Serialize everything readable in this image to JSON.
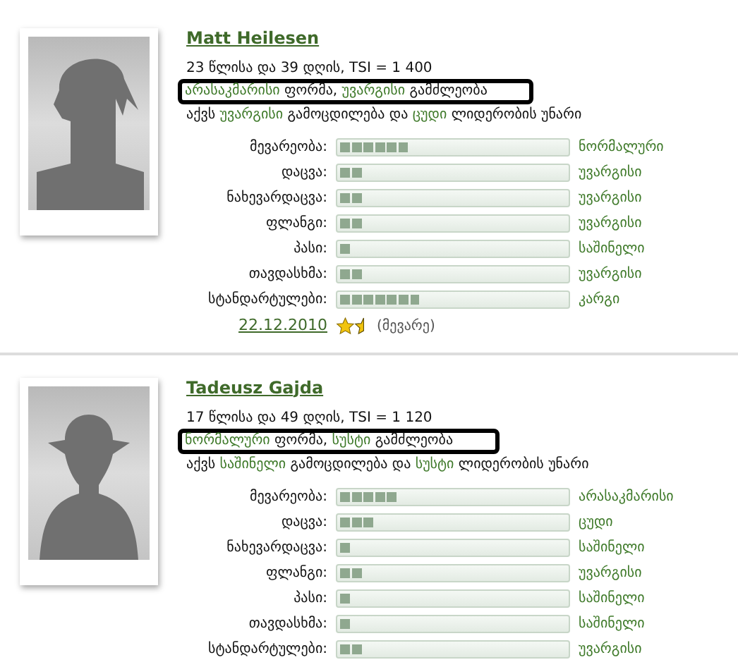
{
  "players": [
    {
      "name": "Matt Heilesen",
      "avatar": {
        "kind": "hair"
      },
      "age_line": "23 წლისა და 39 დღის, TSI = 1 400",
      "form_line": [
        {
          "text": "არასაკმარისი",
          "rated": true
        },
        {
          "text": " ფორმა, ",
          "rated": false
        },
        {
          "text": "უვარგისი",
          "rated": true
        },
        {
          "text": " გამძლეობა",
          "rated": false
        }
      ],
      "form_highlighted": true,
      "experience_line": [
        {
          "text": "აქვს ",
          "rated": false
        },
        {
          "text": "უვარგისი",
          "rated": true
        },
        {
          "text": " გამოცდილება და ",
          "rated": false
        },
        {
          "text": "ცუდი",
          "rated": true
        },
        {
          "text": " ლიდერობის უნარი",
          "rated": false
        }
      ],
      "skills": [
        {
          "label": "მევარეობა:",
          "level": 0.3,
          "rating": "ნორმალური"
        },
        {
          "label": "დაცვა:",
          "level": 0.1,
          "rating": "უვარგისი"
        },
        {
          "label": "ნახევარდაცვა:",
          "level": 0.1,
          "rating": "უვარგისი"
        },
        {
          "label": "ფლანგი:",
          "level": 0.1,
          "rating": "უვარგისი"
        },
        {
          "label": "პასი:",
          "level": 0.05,
          "rating": "საშინელი"
        },
        {
          "label": "თავდასხმა:",
          "level": 0.1,
          "rating": "უვარგისი"
        },
        {
          "label": "სტანდარტულები:",
          "level": 0.35,
          "rating": "კარგი"
        }
      ],
      "date": "22.12.2010",
      "rating_icon": {
        "kind": "star_and_half"
      },
      "position": "(მევარე)"
    },
    {
      "name": "Tadeusz Gajda",
      "avatar": {
        "kind": "bald"
      },
      "age_line": "17 წლისა და 49 დღის, TSI = 1 120",
      "form_line": [
        {
          "text": "ნორმალური",
          "rated": true
        },
        {
          "text": " ფორმა, ",
          "rated": false
        },
        {
          "text": "სუსტი",
          "rated": true
        },
        {
          "text": " გამძლეობა",
          "rated": false
        }
      ],
      "form_highlighted": true,
      "experience_line": [
        {
          "text": "აქვს ",
          "rated": false
        },
        {
          "text": "საშინელი",
          "rated": true
        },
        {
          "text": " გამოცდილება და ",
          "rated": false
        },
        {
          "text": "სუსტი",
          "rated": true
        },
        {
          "text": " ლიდერობის უნარი",
          "rated": false
        }
      ],
      "skills": [
        {
          "label": "მევარეობა:",
          "level": 0.25,
          "rating": "არასაკმარისი"
        },
        {
          "label": "დაცვა:",
          "level": 0.15,
          "rating": "ცუდი"
        },
        {
          "label": "ნახევარდაცვა:",
          "level": 0.05,
          "rating": "საშინელი"
        },
        {
          "label": "ფლანგი:",
          "level": 0.1,
          "rating": "უვარგისი"
        },
        {
          "label": "პასი:",
          "level": 0.05,
          "rating": "საშინელი"
        },
        {
          "label": "თავდასხმა:",
          "level": 0.05,
          "rating": "საშინელი"
        },
        {
          "label": "სტანდარტულები:",
          "level": 0.1,
          "rating": "უვარგისი"
        }
      ]
    }
  ]
}
